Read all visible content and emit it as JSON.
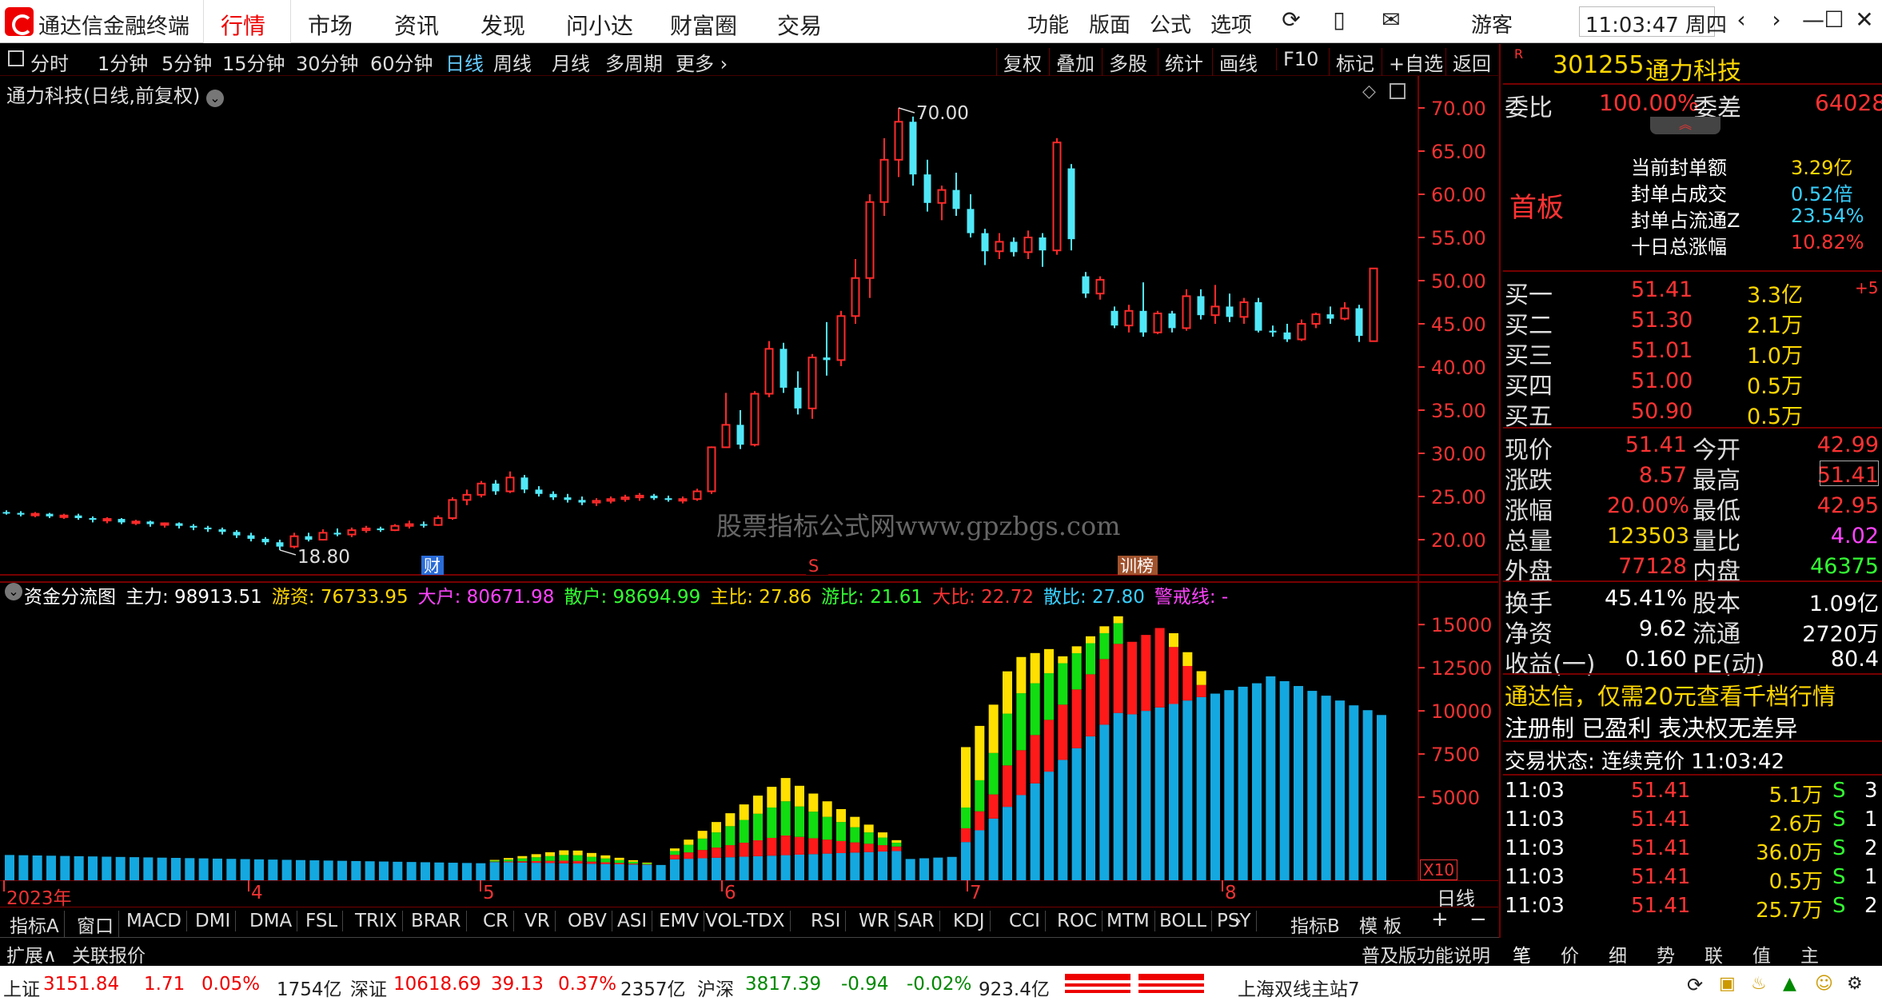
{
  "app": {
    "title": "通达信金融终端"
  },
  "menu": [
    "行情",
    "市场",
    "资讯",
    "发现",
    "问小达",
    "财富圈",
    "交易"
  ],
  "toolbar": [
    "功能",
    "版面",
    "公式",
    "选项"
  ],
  "user": "游客",
  "clock": "11:03:47 周四",
  "periods": [
    "分时",
    "1分钟",
    "5分钟",
    "15分钟",
    "30分钟",
    "60分钟",
    "日线",
    "周线",
    "月线",
    "多周期",
    "更多 ›"
  ],
  "active_period": "日线",
  "right_tools": [
    "复权",
    "叠加",
    "多股",
    "统计",
    "画线",
    "F10",
    "标记",
    "+自选",
    "返回"
  ],
  "chart": {
    "title": "通力科技(日线,前复权)",
    "high_label": "70.00",
    "low_label": "18.80",
    "yticks": [
      "70.00",
      "65.00",
      "60.00",
      "55.00",
      "50.00",
      "45.00",
      "40.00",
      "35.00",
      "30.00",
      "25.00",
      "20.00"
    ],
    "markers": [
      "财",
      "S",
      "训榜"
    ],
    "watermark": "股票指标公式网www.gpzbgs.com"
  },
  "chart_data": [
    {
      "type": "candlestick",
      "ylim": [
        18,
        72
      ],
      "candles": [
        [
          23.2,
          23.4,
          22.9,
          23.1
        ],
        [
          23.1,
          23.3,
          22.7,
          22.9
        ],
        [
          22.9,
          23.2,
          22.6,
          23.0
        ],
        [
          23.0,
          23.1,
          22.5,
          22.7
        ],
        [
          22.7,
          23.0,
          22.4,
          22.8
        ],
        [
          22.8,
          23.0,
          22.3,
          22.5
        ],
        [
          22.5,
          22.7,
          22.0,
          22.3
        ],
        [
          22.3,
          22.6,
          21.9,
          22.4
        ],
        [
          22.4,
          22.5,
          21.8,
          22.0
        ],
        [
          22.0,
          22.3,
          21.7,
          22.1
        ],
        [
          22.1,
          22.2,
          21.5,
          21.8
        ],
        [
          21.8,
          22.0,
          21.4,
          21.9
        ],
        [
          21.9,
          22.0,
          21.3,
          21.6
        ],
        [
          21.6,
          21.8,
          21.1,
          21.4
        ],
        [
          21.4,
          21.6,
          20.9,
          21.2
        ],
        [
          21.2,
          21.4,
          20.6,
          20.9
        ],
        [
          20.9,
          21.1,
          20.2,
          20.5
        ],
        [
          20.5,
          20.8,
          19.8,
          20.1
        ],
        [
          20.1,
          20.3,
          19.4,
          19.7
        ],
        [
          19.7,
          20.0,
          18.8,
          19.2
        ],
        [
          19.2,
          20.8,
          19.0,
          20.4
        ],
        [
          20.4,
          20.8,
          19.8,
          20.0
        ],
        [
          20.0,
          21.2,
          19.9,
          20.8
        ],
        [
          20.8,
          21.3,
          20.4,
          20.6
        ],
        [
          20.6,
          21.4,
          20.3,
          21.1
        ],
        [
          21.1,
          21.6,
          20.8,
          21.3
        ],
        [
          21.3,
          21.5,
          20.9,
          21.1
        ],
        [
          21.1,
          21.8,
          21.0,
          21.6
        ],
        [
          21.6,
          22.2,
          21.3,
          21.8
        ],
        [
          21.8,
          22.1,
          21.4,
          21.7
        ],
        [
          21.7,
          22.8,
          21.6,
          22.5
        ],
        [
          22.5,
          24.9,
          22.3,
          24.6
        ],
        [
          24.6,
          25.8,
          24.0,
          25.2
        ],
        [
          25.2,
          26.8,
          24.9,
          26.5
        ],
        [
          26.5,
          26.9,
          25.2,
          25.6
        ],
        [
          25.6,
          27.9,
          25.4,
          27.2
        ],
        [
          27.2,
          27.5,
          25.4,
          25.8
        ],
        [
          25.8,
          26.2,
          25.0,
          25.3
        ],
        [
          25.3,
          25.6,
          24.6,
          24.9
        ],
        [
          24.9,
          25.3,
          24.3,
          24.6
        ],
        [
          24.6,
          25.0,
          24.0,
          24.3
        ],
        [
          24.3,
          24.8,
          23.9,
          24.5
        ],
        [
          24.5,
          25.0,
          24.2,
          24.7
        ],
        [
          24.7,
          25.2,
          24.4,
          24.9
        ],
        [
          24.9,
          25.4,
          24.5,
          25.1
        ],
        [
          25.1,
          25.3,
          24.6,
          24.8
        ],
        [
          24.8,
          25.1,
          24.4,
          24.6
        ],
        [
          24.6,
          25.0,
          24.2,
          24.7
        ],
        [
          24.7,
          25.9,
          24.5,
          25.6
        ],
        [
          25.6,
          30.8,
          25.3,
          30.7
        ],
        [
          30.7,
          37.0,
          32.0,
          33.3
        ],
        [
          33.3,
          35.0,
          30.5,
          31.0
        ],
        [
          31.0,
          37.2,
          30.8,
          36.9
        ],
        [
          36.9,
          43.0,
          36.5,
          42.1
        ],
        [
          42.1,
          42.8,
          37.0,
          37.6
        ],
        [
          37.6,
          39.5,
          34.5,
          35.2
        ],
        [
          35.2,
          41.5,
          34.0,
          41.1
        ],
        [
          41.1,
          45.2,
          39.0,
          40.8
        ],
        [
          40.8,
          46.5,
          40.1,
          45.9
        ],
        [
          45.9,
          52.5,
          45.0,
          50.3
        ],
        [
          50.3,
          60.0,
          48.0,
          59.1
        ],
        [
          59.1,
          66.5,
          57.5,
          64.0
        ],
        [
          64.0,
          70.0,
          62.0,
          68.4
        ],
        [
          68.4,
          69.0,
          61.0,
          62.3
        ],
        [
          62.3,
          64.0,
          58.0,
          59.0
        ],
        [
          59.0,
          61.0,
          57.0,
          60.5
        ],
        [
          60.5,
          62.5,
          57.5,
          58.3
        ],
        [
          58.3,
          60.0,
          55.0,
          55.5
        ],
        [
          55.5,
          56.0,
          51.8,
          53.4
        ],
        [
          53.4,
          55.5,
          52.5,
          54.5
        ],
        [
          54.5,
          55.0,
          52.8,
          53.3
        ],
        [
          53.3,
          55.8,
          52.5,
          55.0
        ],
        [
          55.0,
          55.5,
          51.6,
          53.5
        ],
        [
          53.5,
          66.5,
          53.0,
          66.0
        ],
        [
          63.0,
          63.5,
          53.5,
          54.8
        ],
        [
          50.5,
          51.0,
          48.0,
          48.5
        ],
        [
          48.5,
          50.5,
          47.8,
          50.1
        ],
        [
          46.5,
          47.0,
          44.5,
          44.8
        ],
        [
          44.8,
          47.2,
          44.0,
          46.5
        ],
        [
          46.5,
          49.8,
          43.5,
          44.0
        ],
        [
          44.0,
          46.5,
          43.8,
          46.2
        ],
        [
          46.2,
          46.5,
          44.0,
          44.5
        ],
        [
          44.5,
          49.0,
          44.2,
          48.2
        ],
        [
          48.2,
          49.0,
          45.5,
          46.0
        ],
        [
          46.0,
          49.5,
          45.0,
          47.0
        ],
        [
          47.0,
          48.5,
          45.2,
          45.8
        ],
        [
          45.8,
          48.0,
          45.0,
          47.5
        ],
        [
          47.5,
          48.0,
          44.0,
          44.2
        ],
        [
          44.2,
          44.8,
          43.5,
          44.0
        ],
        [
          44.0,
          45.0,
          42.9,
          43.2
        ],
        [
          43.2,
          45.5,
          43.0,
          45.0
        ],
        [
          45.0,
          46.3,
          44.5,
          46.1
        ],
        [
          46.1,
          47.0,
          45.0,
          45.6
        ],
        [
          45.6,
          47.5,
          45.4,
          46.8
        ],
        [
          46.8,
          47.2,
          42.9,
          43.6
        ],
        [
          42.99,
          51.41,
          42.95,
          51.41
        ]
      ]
    },
    {
      "type": "stacked-bar",
      "ylim": [
        0,
        17000
      ],
      "yticks": [
        "15000",
        "12500",
        "10000",
        "7500",
        "5000"
      ],
      "series": [
        {
          "name": "散户",
          "color": "#14a8e0"
        },
        {
          "name": "大户",
          "color": "#ff1a1a"
        },
        {
          "name": "游资",
          "color": "#11dd11"
        },
        {
          "name": "主力",
          "color": "#ffe000"
        }
      ],
      "x_labels": [
        "2023年",
        "4",
        "5",
        "6",
        "7",
        "8"
      ]
    }
  ],
  "flow": {
    "title": "资金分流图",
    "items": [
      {
        "label": "主力: 98913.51",
        "color": "#ffffff"
      },
      {
        "label": "游资: 76733.95",
        "color": "#ffd700"
      },
      {
        "label": "大户: 80671.98",
        "color": "#ff44ff"
      },
      {
        "label": "散户: 98694.99",
        "color": "#33ff33"
      },
      {
        "label": "主比: 27.86",
        "color": "#ffd700"
      },
      {
        "label": "游比: 21.61",
        "color": "#33ff33"
      },
      {
        "label": "大比: 22.72",
        "color": "#ff3333"
      },
      {
        "label": "散比: 27.80",
        "color": "#38d0ff"
      },
      {
        "label": "警戒线: -",
        "color": "#ff44ff"
      }
    ],
    "x10": "X10",
    "period_label": "日线"
  },
  "indicators": [
    "指标A",
    "窗口",
    "MACD",
    "DMI",
    "DMA",
    "FSL",
    "TRIX",
    "BRAR",
    "CR",
    "VR",
    "OBV",
    "ASI",
    "EMV",
    "VOL-TDX",
    "RSI",
    "WR",
    "SAR",
    "KDJ",
    "CCI",
    "ROC",
    "MTM",
    "BOLL",
    "PSY"
  ],
  "indicator_b": "指标B",
  "template": "模 板",
  "expand": [
    "扩展∧",
    "关联报价"
  ],
  "pzb": "普及版功能说明",
  "bottom_tabs": [
    "笔",
    "价",
    "细",
    "势",
    "联",
    "值",
    "主"
  ],
  "stock": {
    "tag": "R",
    "code": "301255",
    "name": "通力科技",
    "weibi_label": "委比",
    "weibi": "100.00%",
    "weicha_label": "委差",
    "weicha": "64028",
    "board": "首板",
    "seal": [
      [
        "当前封单额",
        "3.29亿",
        "#ffd700"
      ],
      [
        "封单占成交",
        "0.52倍",
        "#38d0ff"
      ],
      [
        "封单占流通Z",
        "23.54%",
        "#38d0ff"
      ],
      [
        "十日总涨幅",
        "10.82%",
        "#ff3333"
      ]
    ],
    "bids": [
      [
        "买一",
        "51.41",
        "3.3亿",
        "+5"
      ],
      [
        "买二",
        "51.30",
        "2.1万",
        ""
      ],
      [
        "买三",
        "51.01",
        "1.0万",
        ""
      ],
      [
        "买四",
        "51.00",
        "0.5万",
        ""
      ],
      [
        "买五",
        "50.90",
        "0.5万",
        ""
      ]
    ],
    "quote": [
      [
        "现价",
        "51.41",
        "#ff3333",
        "今开",
        "42.99",
        "#ff3333"
      ],
      [
        "涨跌",
        "8.57",
        "#ff3333",
        "最高",
        "51.41",
        "#ff3333"
      ],
      [
        "涨幅",
        "20.00%",
        "#ff3333",
        "最低",
        "42.95",
        "#ff3333"
      ],
      [
        "总量",
        "123503",
        "#ffd700",
        "量比",
        "4.02",
        "#ff44ff"
      ],
      [
        "外盘",
        "77128",
        "#ff3333",
        "内盘",
        "46375",
        "#33ff33"
      ]
    ],
    "fund": [
      [
        "换手",
        "45.41%",
        "股本",
        "1.09亿"
      ],
      [
        "净资",
        "9.62",
        "流通",
        "2720万"
      ],
      [
        "收益(一)",
        "0.160",
        "PE(动)",
        "80.4"
      ]
    ],
    "ad": "通达信，仅需20元查看千档行情",
    "reg": "注册制 已盈利 表决权无差异",
    "trade_state": "交易状态: 连续竞价 11:03:42",
    "ticks": [
      [
        "11:03",
        "51.41",
        "5.1万",
        "S",
        "3"
      ],
      [
        "11:03",
        "51.41",
        "2.6万",
        "S",
        "1"
      ],
      [
        "11:03",
        "51.41",
        "36.0万",
        "S",
        "2"
      ],
      [
        "11:03",
        "51.41",
        "0.5万",
        "S",
        "1"
      ],
      [
        "11:03",
        "51.41",
        "25.7万",
        "S",
        "2"
      ]
    ]
  },
  "status": {
    "items": [
      [
        "上证",
        "#222"
      ],
      [
        "3151.84",
        "#e00"
      ],
      [
        "1.71",
        "#e00"
      ],
      [
        "0.05%",
        "#e00"
      ],
      [
        "1754亿",
        "#222"
      ],
      [
        "深证",
        "#222"
      ],
      [
        "10618.69",
        "#e00"
      ],
      [
        "39.13",
        "#e00"
      ],
      [
        "0.37%",
        "#e00"
      ],
      [
        "2357亿",
        "#222"
      ],
      [
        "沪深",
        "#222"
      ],
      [
        "3817.39",
        "#080"
      ],
      [
        "-0.94",
        "#080"
      ],
      [
        "-0.02%",
        "#080"
      ],
      [
        "923.4亿",
        "#222"
      ]
    ],
    "server": "上海双线主站7"
  }
}
